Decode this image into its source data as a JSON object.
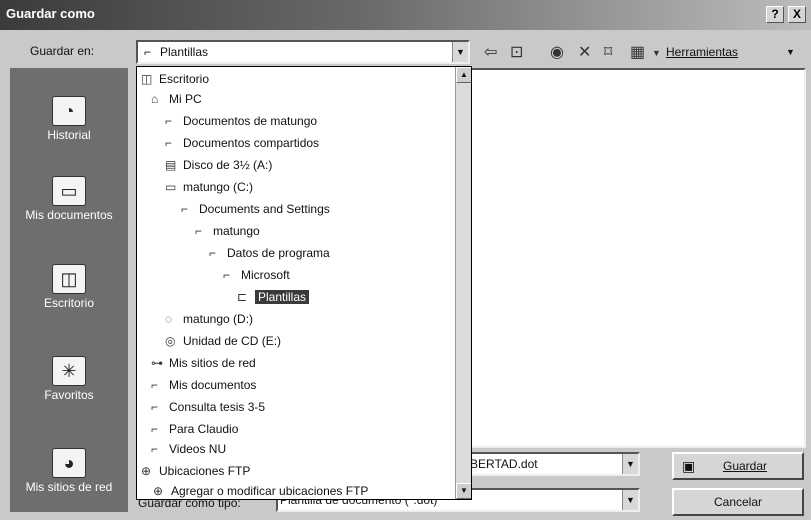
{
  "window": {
    "title": "Guardar como",
    "help": "?",
    "close": "X"
  },
  "location": {
    "label": "Guardar en:",
    "value": "Plantillas"
  },
  "toolbar": {
    "tools_label": "Herramientas"
  },
  "places": [
    {
      "label": "Historial",
      "icon": "history-icon"
    },
    {
      "label": "Mis documentos",
      "icon": "my-documents-icon"
    },
    {
      "label": "Escritorio",
      "icon": "desktop-icon"
    },
    {
      "label": "Favoritos",
      "icon": "favorites-icon"
    },
    {
      "label": "Mis sitios de red",
      "icon": "network-places-icon"
    }
  ],
  "tree": [
    {
      "label": "Escritorio",
      "icon": "desktop-icon"
    },
    {
      "label": "Mi PC",
      "icon": "computer-icon"
    },
    {
      "label": "Documentos de matungo",
      "icon": "folder-icon"
    },
    {
      "label": "Documentos compartidos",
      "icon": "folder-icon"
    },
    {
      "label": "Disco de 3½ (A:)",
      "icon": "floppy-icon"
    },
    {
      "label": "matungo (C:)",
      "icon": "drive-icon"
    },
    {
      "label": "Documents and Settings",
      "icon": "folder-icon"
    },
    {
      "label": "matungo",
      "icon": "folder-icon"
    },
    {
      "label": "Datos de programa",
      "icon": "folder-icon"
    },
    {
      "label": "Microsoft",
      "icon": "folder-icon"
    },
    {
      "label": "Plantillas",
      "icon": "open-folder-icon",
      "selected": true
    },
    {
      "label": "matungo (D:)",
      "icon": "drive-icon"
    },
    {
      "label": "Unidad de CD (E:)",
      "icon": "cd-drive-icon"
    },
    {
      "label": "Mis sitios de red",
      "icon": "network-icon"
    },
    {
      "label": "Mis documentos",
      "icon": "folder-icon"
    },
    {
      "label": "Consulta tesis 3-5",
      "icon": "folder-icon"
    },
    {
      "label": "Para Claudio",
      "icon": "folder-icon"
    },
    {
      "label": "Videos NU",
      "icon": "folder-icon"
    },
    {
      "label": "Ubicaciones FTP",
      "icon": "ftp-icon"
    },
    {
      "label": "Agregar o modificar ubicaciones FTP",
      "icon": "ftp-icon"
    }
  ],
  "filename": {
    "value": "BERTAD.dot"
  },
  "filetype": {
    "label": "Guardar como tipo:",
    "value": "Plantilla de documento (*.dot)"
  },
  "buttons": {
    "save": "Guardar",
    "cancel": "Cancelar"
  }
}
